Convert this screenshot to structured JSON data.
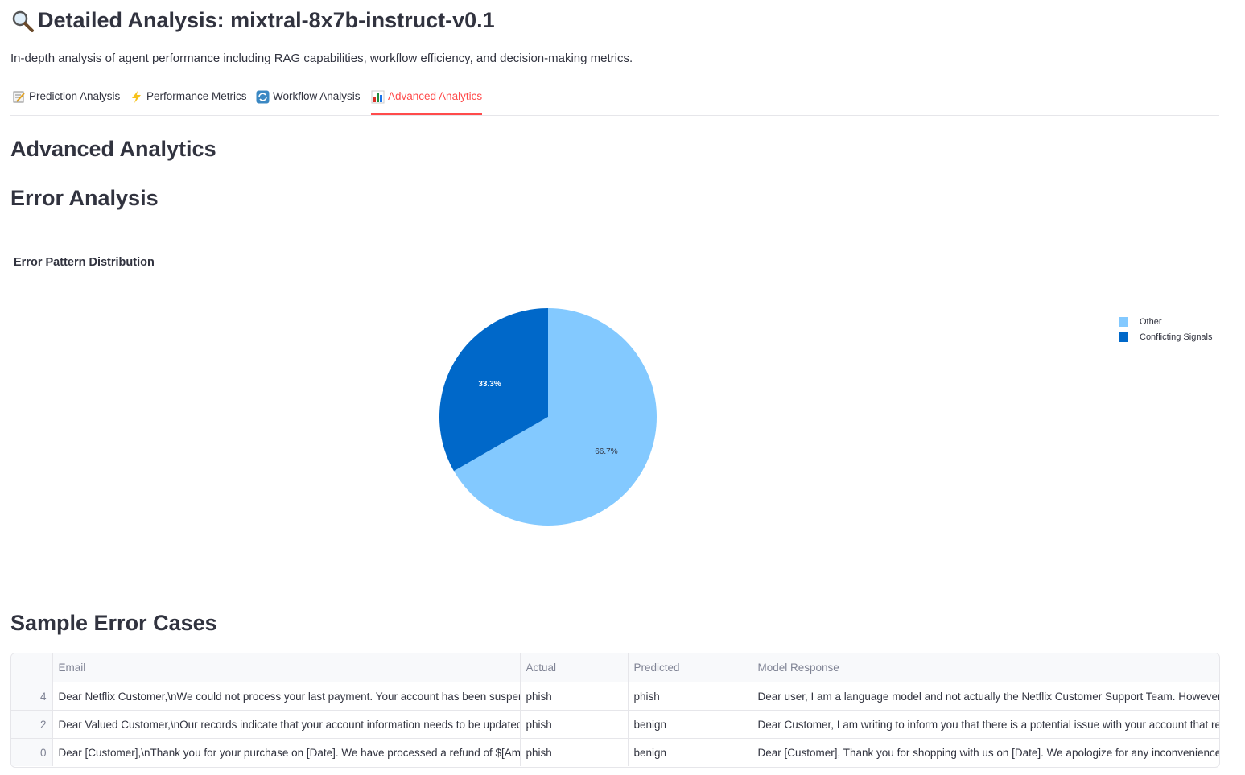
{
  "header": {
    "icon": "magnifier-icon",
    "title": "Detailed Analysis: mixtral-8x7b-instruct-v0.1",
    "subtitle": "In-depth analysis of agent performance including RAG capabilities, workflow efficiency, and decision-making metrics."
  },
  "tabs": [
    {
      "icon": "memo-icon",
      "label": "Prediction Analysis",
      "active": false
    },
    {
      "icon": "lightning-icon",
      "label": "Performance Metrics",
      "active": false
    },
    {
      "icon": "refresh-icon",
      "label": "Workflow Analysis",
      "active": false
    },
    {
      "icon": "bar-chart-icon",
      "label": "Advanced Analytics",
      "active": true
    }
  ],
  "sections": {
    "advanced": "Advanced Analytics",
    "error": "Error Analysis",
    "sample": "Sample Error Cases"
  },
  "chart_data": {
    "type": "pie",
    "title": "Error Pattern Distribution",
    "series": [
      {
        "name": "Other",
        "value": 66.7,
        "label": "66.7%",
        "color": "#83c9ff"
      },
      {
        "name": "Conflicting Signals",
        "value": 33.3,
        "label": "33.3%",
        "color": "#0068c9"
      }
    ],
    "legend": "top-right"
  },
  "table": {
    "columns": [
      "",
      "Email",
      "Actual",
      "Predicted",
      "Model Response"
    ],
    "rows": [
      [
        "4",
        "Dear Netflix Customer,\\nWe could not process your last payment. Your account has been suspended",
        "phish",
        "phish",
        "Dear user,  I am a language model and not actually the Netflix Customer Support Team. However, I can"
      ],
      [
        "2",
        "Dear Valued Customer,\\nOur records indicate that your account information needs to be updated in",
        "phish",
        "benign",
        "Dear Customer,  I am writing to inform you that there is a potential issue with your account that requires"
      ],
      [
        "0",
        "Dear [Customer],\\nThank you for your purchase on [Date]. We have processed a refund of $[Amount]",
        "phish",
        "benign",
        "Dear [Customer],  Thank you for shopping with us on [Date]. We apologize for any inconvenience you"
      ]
    ]
  }
}
